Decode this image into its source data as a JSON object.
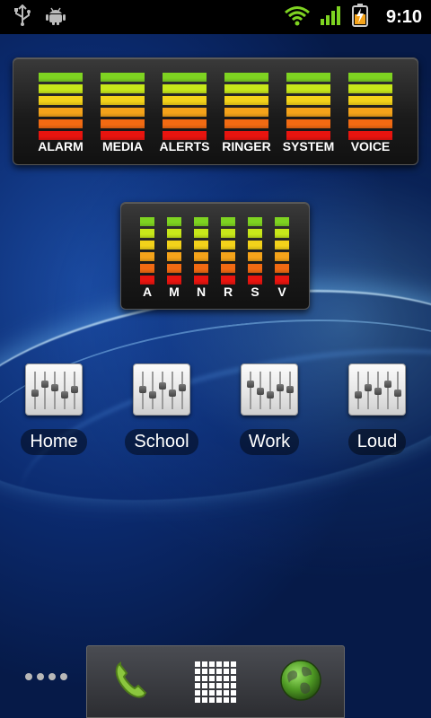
{
  "status_bar": {
    "left_icons": [
      "usb-icon",
      "android-debug-icon"
    ],
    "right_icons": [
      "wifi-icon",
      "signal-icon",
      "battery-charging-icon"
    ],
    "time": "9:10"
  },
  "widget_large": {
    "labels": [
      "ALARM",
      "MEDIA",
      "ALERTS",
      "RINGER",
      "SYSTEM",
      "VOICE"
    ]
  },
  "widget_small": {
    "labels": [
      "A",
      "M",
      "N",
      "R",
      "S",
      "V"
    ]
  },
  "meter_colors": [
    "#7ed321",
    "#c8e81a",
    "#f3d21a",
    "#f5a31a",
    "#f26a12",
    "#e8140f"
  ],
  "profiles": [
    {
      "label": "Home",
      "icon": "mixer-icon"
    },
    {
      "label": "School",
      "icon": "mixer-icon"
    },
    {
      "label": "Work",
      "icon": "mixer-icon"
    },
    {
      "label": "Loud",
      "icon": "mixer-icon"
    }
  ],
  "dock": {
    "items": [
      "phone-icon",
      "app-drawer-icon",
      "browser-globe-icon"
    ],
    "page_indicator": "more-dots-icon"
  }
}
